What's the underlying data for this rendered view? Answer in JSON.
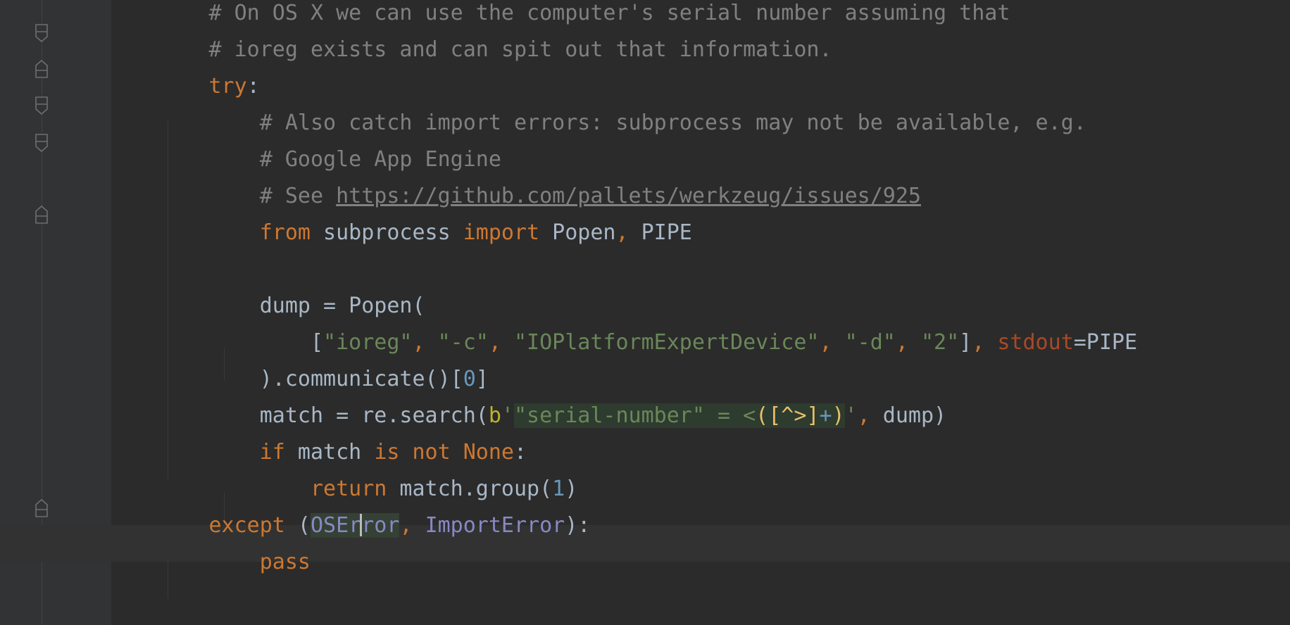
{
  "editor": {
    "lines": [
      {
        "indent": "        ",
        "tokens": [
          {
            "text": "# On OS X we can use the computer's serial number assuming that",
            "cls": "c-comment"
          }
        ]
      },
      {
        "indent": "        ",
        "tokens": [
          {
            "text": "# ioreg exists and can spit out that information.",
            "cls": "c-comment"
          }
        ]
      },
      {
        "indent": "        ",
        "tokens": [
          {
            "text": "try",
            "cls": "c-keyword"
          },
          {
            "text": ":",
            "cls": "c-default"
          }
        ]
      },
      {
        "indent": "            ",
        "tokens": [
          {
            "text": "# Also catch import errors: subprocess may not be available, e.g.",
            "cls": "c-comment"
          }
        ]
      },
      {
        "indent": "            ",
        "tokens": [
          {
            "text": "# Google App Engine",
            "cls": "c-comment"
          }
        ]
      },
      {
        "indent": "            ",
        "tokens": [
          {
            "text": "# See ",
            "cls": "c-comment"
          },
          {
            "text": "https://github.com/pallets/werkzeug/issues/925",
            "cls": "c-link"
          }
        ]
      },
      {
        "indent": "            ",
        "tokens": [
          {
            "text": "from",
            "cls": "c-keyword"
          },
          {
            "text": " subprocess ",
            "cls": "c-default"
          },
          {
            "text": "import",
            "cls": "c-keyword"
          },
          {
            "text": " Popen",
            "cls": "c-default"
          },
          {
            "text": ",",
            "cls": "c-punct"
          },
          {
            "text": " PIPE",
            "cls": "c-default"
          }
        ]
      },
      {
        "indent": "",
        "tokens": []
      },
      {
        "indent": "            ",
        "tokens": [
          {
            "text": "dump = Popen(",
            "cls": "c-default"
          }
        ]
      },
      {
        "indent": "                ",
        "tokens": [
          {
            "text": "[",
            "cls": "c-default"
          },
          {
            "text": "\"ioreg\"",
            "cls": "c-string"
          },
          {
            "text": ", ",
            "cls": "c-punct"
          },
          {
            "text": "\"-c\"",
            "cls": "c-string"
          },
          {
            "text": ", ",
            "cls": "c-punct"
          },
          {
            "text": "\"IOPlatformExpertDevice\"",
            "cls": "c-string"
          },
          {
            "text": ", ",
            "cls": "c-punct"
          },
          {
            "text": "\"-d\"",
            "cls": "c-string"
          },
          {
            "text": ", ",
            "cls": "c-punct"
          },
          {
            "text": "\"2\"",
            "cls": "c-string"
          },
          {
            "text": "]",
            "cls": "c-default"
          },
          {
            "text": ", ",
            "cls": "c-punct"
          },
          {
            "text": "stdout",
            "cls": "c-kwarg"
          },
          {
            "text": "=PIPE",
            "cls": "c-default"
          }
        ]
      },
      {
        "indent": "            ",
        "tokens": [
          {
            "text": ").communicate()[",
            "cls": "c-default"
          },
          {
            "text": "0",
            "cls": "c-number"
          },
          {
            "text": "]",
            "cls": "c-default"
          }
        ]
      },
      {
        "indent": "            ",
        "tokens": [
          {
            "text": "match = re.search(",
            "cls": "c-default"
          },
          {
            "text": "b",
            "cls": "c-bprefix"
          },
          {
            "text": "'",
            "cls": "c-string"
          },
          {
            "text": "\"serial-number\" = <",
            "cls": "c-regex-plain"
          },
          {
            "text": "(",
            "cls": "c-regex-bracket"
          },
          {
            "text": "[",
            "cls": "c-regex-bracket"
          },
          {
            "text": "^>",
            "cls": "c-regex-bracket"
          },
          {
            "text": "]",
            "cls": "c-regex-bracket"
          },
          {
            "text": "+",
            "cls": "c-regex-op"
          },
          {
            "text": ")",
            "cls": "c-regex-bracket"
          },
          {
            "text": "'",
            "cls": "c-string"
          },
          {
            "text": ", ",
            "cls": "c-punct"
          },
          {
            "text": "dump)",
            "cls": "c-default"
          }
        ]
      },
      {
        "indent": "            ",
        "tokens": [
          {
            "text": "if",
            "cls": "c-keyword"
          },
          {
            "text": " match ",
            "cls": "c-default"
          },
          {
            "text": "is not None",
            "cls": "c-keyword"
          },
          {
            "text": ":",
            "cls": "c-default"
          }
        ]
      },
      {
        "indent": "                ",
        "tokens": [
          {
            "text": "return",
            "cls": "c-keyword"
          },
          {
            "text": " match.group(",
            "cls": "c-default"
          },
          {
            "text": "1",
            "cls": "c-number"
          },
          {
            "text": ")",
            "cls": "c-default"
          }
        ]
      },
      {
        "indent": "        ",
        "tokens": [
          {
            "text": "except",
            "cls": "c-keyword"
          },
          {
            "text": " (",
            "cls": "c-default"
          },
          {
            "text": "OSEr",
            "cls": "c-ident-hl"
          },
          {
            "text": "CARET",
            "cls": "caret"
          },
          {
            "text": "ror",
            "cls": "c-ident-hl"
          },
          {
            "text": ", ",
            "cls": "c-punct"
          },
          {
            "text": "ImportError",
            "cls": "c-builtin"
          },
          {
            "text": "):",
            "cls": "c-default"
          }
        ]
      },
      {
        "indent": "            ",
        "tokens": [
          {
            "text": "pass",
            "cls": "c-keyword"
          }
        ]
      }
    ]
  },
  "colors": {
    "background": "#2b2b2b",
    "gutter": "#313335",
    "comment": "#808080",
    "keyword": "#cc7832",
    "string": "#6a8759",
    "number": "#6897bb",
    "builtin": "#8888c6"
  }
}
